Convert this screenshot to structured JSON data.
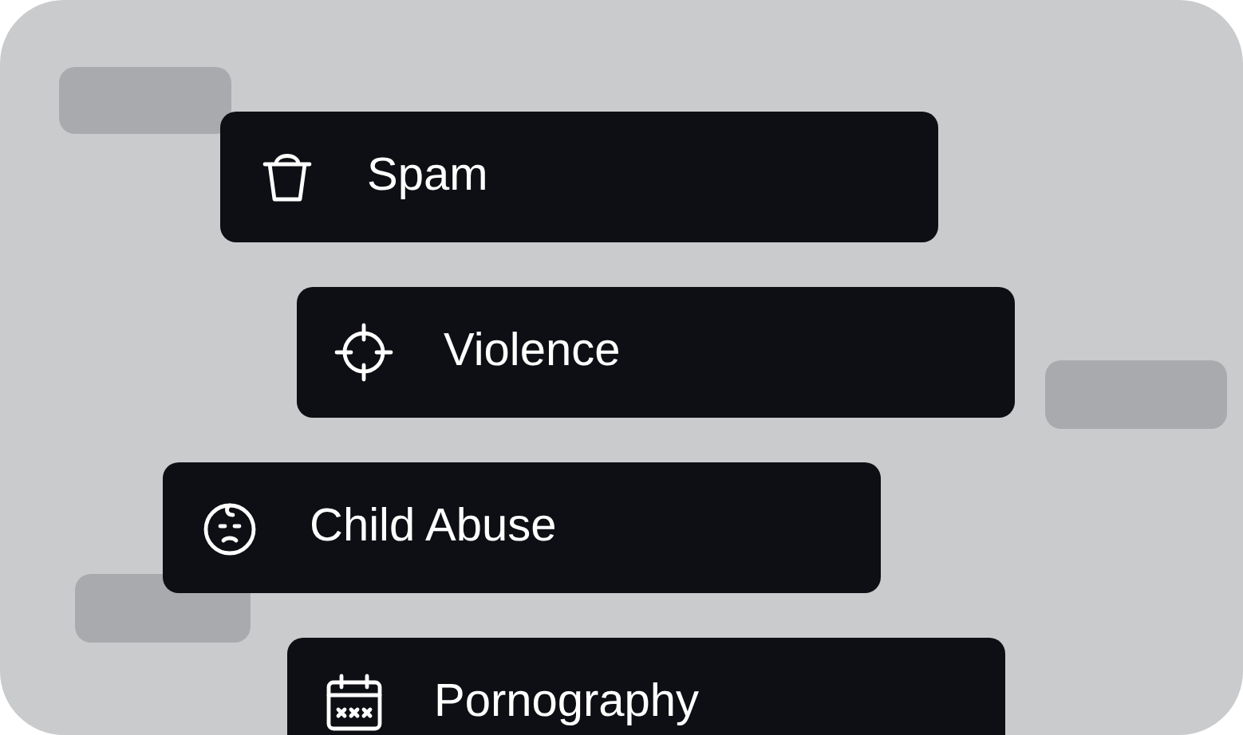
{
  "categories": [
    {
      "label": "Spam",
      "kind": "bucket"
    },
    {
      "label": "Violence",
      "kind": "crosshair"
    },
    {
      "label": "Child Abuse",
      "kind": "baby"
    },
    {
      "label": "Pornography",
      "kind": "calendar"
    }
  ]
}
